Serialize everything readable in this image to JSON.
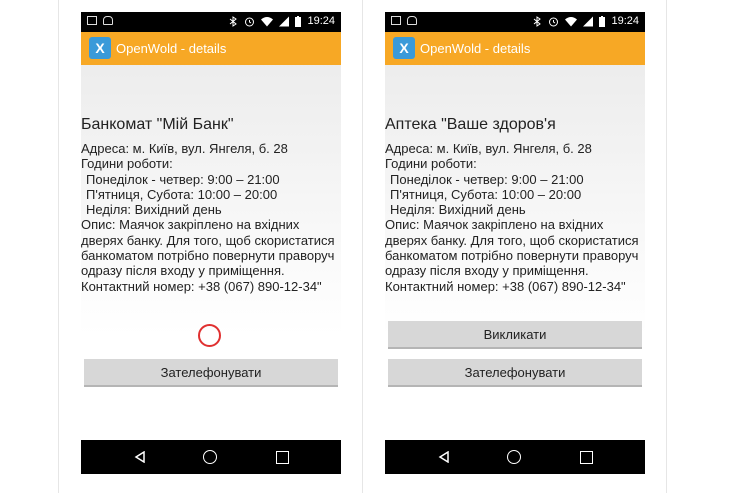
{
  "status_bar": {
    "time": "19:24"
  },
  "app": {
    "logo_glyph": "X",
    "title": "OpenWold - details"
  },
  "screens": [
    {
      "title": "Банкомат \"Мій Банк\"",
      "address": "Адреса: м. Київ, вул. Янгеля, б. 28",
      "hours_label": "Години роботи:",
      "hours_weekdays": "Понеділок - четвер: 9:00 – 21:00",
      "hours_fri_sat": "П'ятниця, Субота: 10:00 – 20:00",
      "hours_sunday": "Неділя: Вихідний день",
      "desc_line1": "Опис: Маячок закріплено на вхідних",
      "desc_line2": "дверях банку. Для того, щоб скористатися",
      "desc_line3": "банкоматом потрібно повернути праворуч",
      "desc_line4": "одразу після входу у приміщення.",
      "contact": "Контактний номер: +38 (067) 890-12-34\"",
      "call_button": "Зателефонувати"
    },
    {
      "title": "Аптека \"Ваше здоров'я",
      "address": "Адреса: м. Київ, вул. Янгеля, б. 28",
      "hours_label": "Години роботи:",
      "hours_weekdays": "Понеділок - четвер: 9:00 – 21:00",
      "hours_fri_sat": "П'ятниця, Субота: 10:00 – 20:00",
      "hours_sunday": "Неділя: Вихідний день",
      "desc_line1": "Опис: Маячок закріплено на вхідних",
      "desc_line2": "дверях банку. Для того, щоб скористатися",
      "desc_line3": "банкоматом потрібно повернути праворуч",
      "desc_line4": "одразу після входу у приміщення.",
      "contact": "Контактний номер: +38 (067) 890-12-34\"",
      "summon_button": "Викликати",
      "call_button": "Зателефонувати"
    }
  ],
  "colors": {
    "app_bar": "#f7a825",
    "logo_bg": "#3a9ad9",
    "spinner": "#e03030"
  },
  "icons": [
    "image-icon",
    "android-icon",
    "bluetooth-icon",
    "alarm-icon",
    "wifi-icon",
    "signal-icon",
    "battery-icon",
    "back-icon",
    "home-icon",
    "recent-apps-icon"
  ]
}
